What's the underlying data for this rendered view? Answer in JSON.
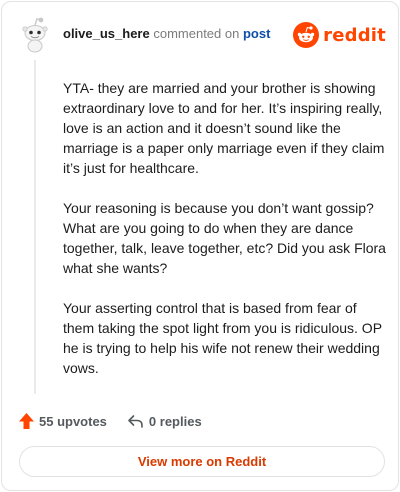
{
  "header": {
    "username": "olive_us_here",
    "commented_text": "commented on",
    "post_link": "post"
  },
  "brand": {
    "name": "reddit",
    "color": "#ff4500"
  },
  "comment": {
    "paragraphs": [
      "YTA- they are married and your brother is showing extraordinary love to and for her. It’s inspiring really, love is an action and it doesn’t sound like the marriage is a paper only marriage even if they claim it’s just for healthcare.",
      "Your reasoning is because you don’t want gossip? What are you going to do when they are dance together, talk, leave together, etc? Did you ask Flora what she wants?",
      "Your asserting control that is based from fear of them taking the spot light from you is ridiculous. OP he is trying to help his wife not renew their wedding vows."
    ]
  },
  "actions": {
    "upvotes_label": "55 upvotes",
    "replies_label": "0 replies"
  },
  "footer": {
    "view_more_label": "View more on Reddit"
  },
  "icons": {
    "avatar": "snoo-avatar-icon",
    "logo": "reddit-snoo-icon",
    "upvote": "upvote-arrow-icon",
    "reply": "reply-arrow-icon"
  }
}
